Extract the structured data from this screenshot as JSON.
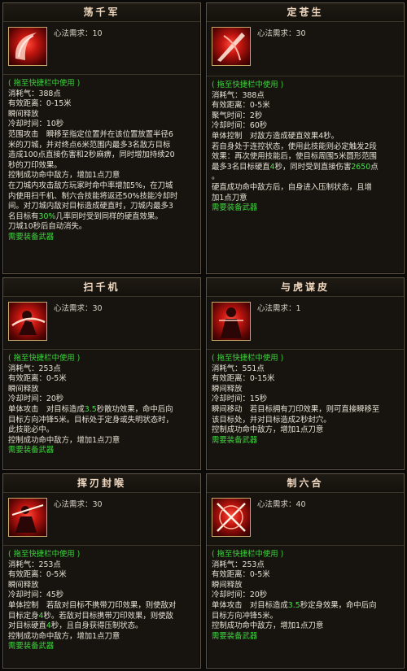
{
  "colors": {
    "accent_green": "#3ed23e",
    "border": "#5a5346",
    "icon_red": "#c2150f"
  },
  "cards": [
    {
      "title": "荡千军",
      "icon": "crescent-slash-icon",
      "req": "心法需求：10",
      "tag": "( 拖至快捷栏中使用 )",
      "stats": [
        "消耗气：388点",
        "有效距离：0-15米",
        "瞬间释放",
        "冷却时间：10秒"
      ],
      "desc": [
        "范围攻击　瞬移至指定位置并在该位置放置半径6",
        "米的刀城，并对终点6米范围内最多3名敌方目标",
        "造成100点直接伤害和2秒麻痹，同时增加持续20",
        "秒的刀印效果。",
        "控制成功命中敌方，增加1点刀意",
        "在刀城内攻击敌方玩家时命中率增加5%，在刀城",
        "内使用扫千机、制六合技能将返还50%技能冷却时",
        "间。对刀城内敌对目标造成硬直时，刀城内最多3",
        "名目标有30%几率同时受到同样的硬直效果。",
        "刀城10秒后自动消失。"
      ],
      "footer": "需要装备武器"
    },
    {
      "title": "定苍生",
      "icon": "blade-strike-icon",
      "req": "心法需求：30",
      "tag": "( 拖至快捷栏中使用 )",
      "stats": [
        "消耗气：388点",
        "有效距离：0-5米",
        "聚气时间：2秒",
        "冷却时间：60秒"
      ],
      "desc": [
        "单体控制　对敌方造成硬直效果4秒。",
        "若自身处于连控状态，使用此技能则必定触发2段",
        "效果：再次使用技能后，使目标周围5米圆形范围",
        "最多3名目标硬直4秒，同时受到直接伤害2650点",
        "。",
        "硬直成功命中敌方后，自身进入压制状态，且增",
        "加1点刀意"
      ],
      "footer": "需要装备武器"
    },
    {
      "title": "扫千机",
      "icon": "sweep-slash-icon",
      "req": "心法需求：30",
      "tag": "( 拖至快捷栏中使用 )",
      "stats": [
        "消耗气：253点",
        "有效距离：0-5米",
        "瞬间释放",
        "冷却时间：20秒"
      ],
      "desc": [
        "单体攻击　对目标造成3.5秒散功效果，命中后向",
        "目标方向冲锋5米。目标处于定身或失明状态时，",
        "此技能必中。",
        "控制成功命中敌方，增加1点刀意"
      ],
      "footer": "需要装备武器"
    },
    {
      "title": "与虎谋皮",
      "icon": "warrior-stance-icon",
      "req": "心法需求：1",
      "tag": "( 拖至快捷栏中使用 )",
      "stats": [
        "消耗气：551点",
        "有效距离：0-15米",
        "瞬间释放",
        "冷却时间：15秒"
      ],
      "desc": [
        "瞬间移动　若目标拥有刀印效果，则可直接瞬移至",
        "该目标处，并对目标造成2秒封穴。",
        "控制成功命中敌方，增加1点刀意"
      ],
      "footer": "需要装备武器"
    },
    {
      "title": "挥刃封喉",
      "icon": "throat-cut-icon",
      "req": "心法需求：30",
      "tag": "( 拖至快捷栏中使用 )",
      "stats": [
        "消耗气：253点",
        "有效距离：0-5米",
        "瞬间释放",
        "冷却时间：45秒"
      ],
      "desc": [
        "单体控制　若敌对目标不携带刀印效果，则使敌对",
        "目标定身4秒。若敌对目标携带刀印效果，则使敌",
        "对目标硬直4秒，且自身获得压制状态。",
        "控制成功命中敌方，增加1点刀意"
      ],
      "footer": "需要装备武器"
    },
    {
      "title": "制六合",
      "icon": "crossed-blades-icon",
      "req": "心法需求：40",
      "tag": "( 拖至快捷栏中使用 )",
      "stats": [
        "消耗气：253点",
        "有效距离：0-5米",
        "瞬间释放",
        "冷却时间：20秒"
      ],
      "desc": [
        "单体攻击　对目标造成3.5秒定身效果，命中后向",
        "目标方向冲锋5米。",
        "控制成功命中敌方，增加1点刀意"
      ],
      "footer": "需要装备武器"
    }
  ]
}
